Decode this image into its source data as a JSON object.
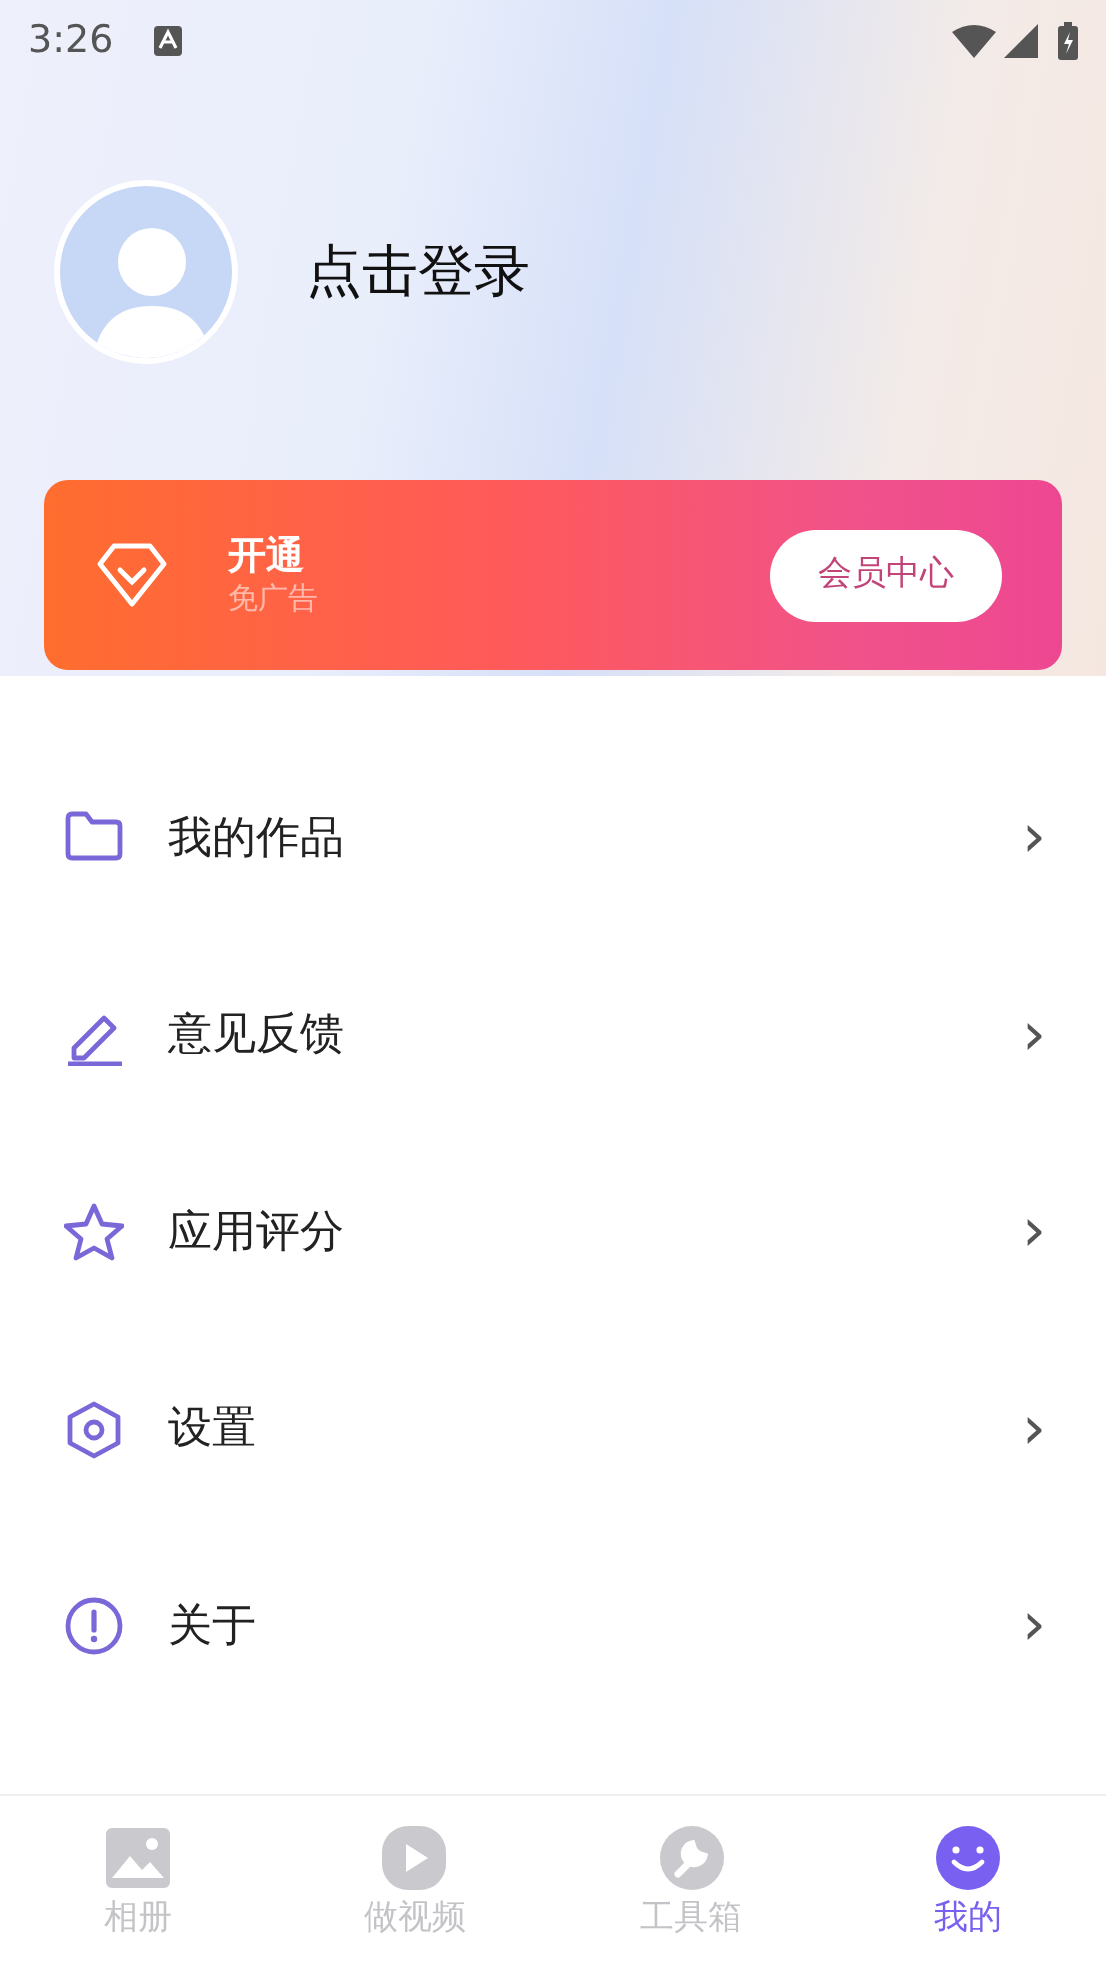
{
  "status_bar": {
    "time": "3:26"
  },
  "profile": {
    "login_label": "点击登录"
  },
  "vip_banner": {
    "title": "开通",
    "subtitle": "免广告",
    "button": "会员中心"
  },
  "menu": [
    {
      "label": "我的作品",
      "chevron": "›"
    },
    {
      "label": "意见反馈",
      "chevron": "›"
    },
    {
      "label": "应用评分",
      "chevron": "›"
    },
    {
      "label": "设置",
      "chevron": "›"
    },
    {
      "label": "关于",
      "chevron": "›"
    }
  ],
  "bottom_nav": [
    {
      "label": "相册",
      "selected": false
    },
    {
      "label": "做视频",
      "selected": false
    },
    {
      "label": "工具箱",
      "selected": false
    },
    {
      "label": "我的",
      "selected": true
    }
  ]
}
